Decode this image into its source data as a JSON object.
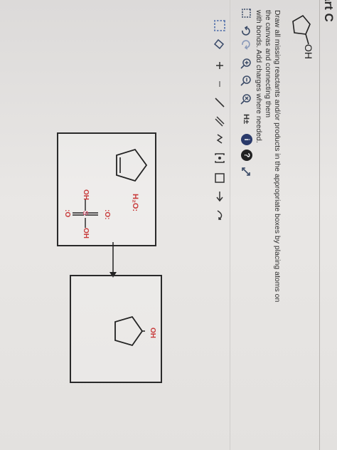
{
  "header": {
    "part_label": "art C"
  },
  "target_molecule": {
    "label": "OH"
  },
  "instructions": {
    "line1": "Draw all missing reactants and/or products in the appropriate boxes by placing atoms on the canvas and connecting them",
    "line2": "with bonds. Add charges where needed."
  },
  "toolbar": {
    "h_label": "H±",
    "info_label": "i",
    "help_label": "?"
  },
  "reaction": {
    "reactant_box": {
      "water_label": "H₂O:",
      "acid_o_top": ":O:",
      "acid_o_left": ":O",
      "acid_o_right": "OH",
      "acid_o_bottom": "OH",
      "acid_s": "S"
    },
    "product_box": {
      "oh_label": "OH"
    }
  },
  "colors": {
    "accent": "#2a3a6a",
    "oxygen": "#c83a3a",
    "sulfur": "#d65e78"
  }
}
